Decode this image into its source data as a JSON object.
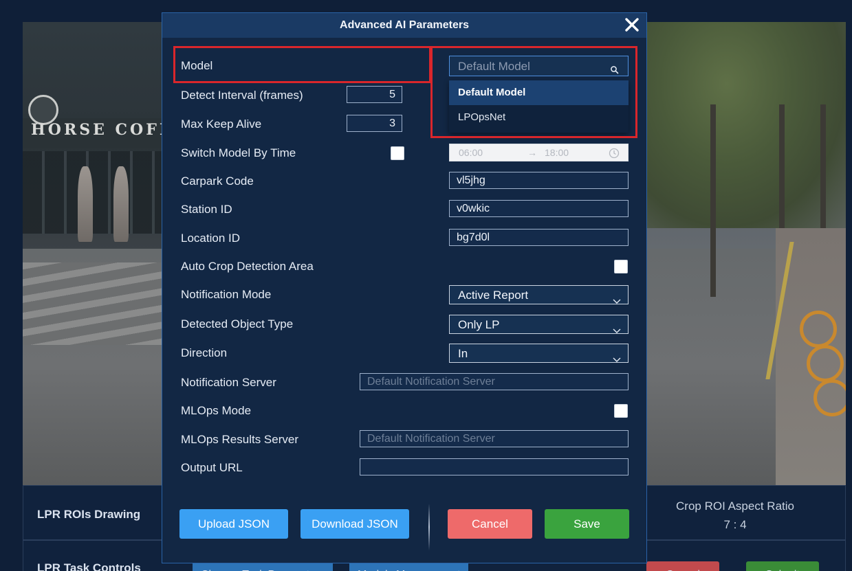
{
  "background": {
    "sign_text": "HORSE COFFEE",
    "rows": [
      {
        "label": "LPR ROIs Drawing",
        "aspect_label": "Crop ROI Aspect Ratio",
        "aspect_value": "7 : 4"
      },
      {
        "label": "LPR Task Controls",
        "buttons": [
          "Change Task Parameters",
          "Models Management",
          "Cancel",
          "Submit"
        ]
      }
    ]
  },
  "modal": {
    "title": "Advanced AI Parameters",
    "close_icon": "close-icon",
    "fields": {
      "model": {
        "label": "Model",
        "placeholder": "Default Model",
        "icon": "search-icon"
      },
      "model_options": [
        "Default Model",
        "LPOpsNet"
      ],
      "model_selected": "Default Model",
      "detect_interval": {
        "label": "Detect Interval (frames)",
        "value": "5"
      },
      "max_keep_alive": {
        "label": "Max Keep Alive",
        "value": "3"
      },
      "switch_model_by_time": {
        "label": "Switch Model By Time",
        "checked": false,
        "start": "06:00",
        "arrow": "→",
        "end": "18:00",
        "icon": "clock-icon"
      },
      "carpark_code": {
        "label": "Carpark Code",
        "value": "vl5jhg"
      },
      "station_id": {
        "label": "Station ID",
        "value": "v0wkic"
      },
      "location_id": {
        "label": "Location ID",
        "value": "bg7d0l"
      },
      "auto_crop": {
        "label": "Auto Crop Detection Area",
        "checked": false
      },
      "notification_mode": {
        "label": "Notification Mode",
        "value": "Active Report"
      },
      "detected_object_type": {
        "label": "Detected Object Type",
        "value": "Only LP"
      },
      "direction": {
        "label": "Direction",
        "value": "In"
      },
      "notification_server": {
        "label": "Notification Server",
        "placeholder": "Default Notification Server"
      },
      "mlops_mode": {
        "label": "MLOps Mode",
        "checked": false
      },
      "mlops_results_server": {
        "label": "MLOps Results Server",
        "placeholder": "Default Notification Server"
      },
      "output_url": {
        "label": "Output URL",
        "value": ""
      }
    },
    "buttons": {
      "upload": "Upload JSON",
      "download": "Download JSON",
      "cancel": "Cancel",
      "save": "Save"
    }
  },
  "colors": {
    "highlight": "#d9262b",
    "primary_button": "#3aa0f3",
    "cancel_button": "#ee6a6a",
    "save_button": "#3aa33e",
    "modal_bg": "#122744"
  }
}
